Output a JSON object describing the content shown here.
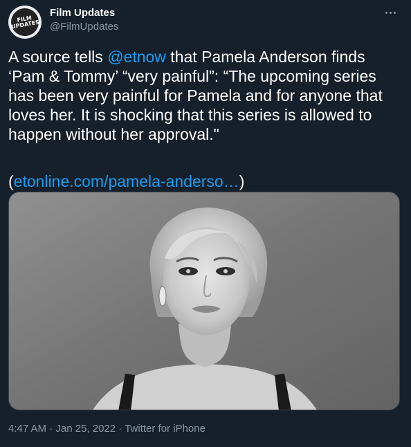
{
  "account": {
    "display_name": "Film Updates",
    "handle": "@FilmUpdates",
    "avatar_text_line1": "FILM",
    "avatar_text_line2": "UPDATES"
  },
  "tweet": {
    "text_part1": "A source tells ",
    "mention": "@etnow",
    "text_part2": " that Pamela Anderson finds ‘Pam & Tommy’ “very painful”: “The upcoming series has been very painful for Pamela and for anyone that loves her. It is shocking that this series is allowed to happen without her approval.\"",
    "link_open": "(",
    "link_text": "etonline.com/pamela-anderso…",
    "link_close": ")",
    "time": "4:47 AM",
    "date": "Jan 25, 2022",
    "source": "Twitter for iPhone",
    "separator": " · "
  },
  "icons": {
    "more": "more-icon",
    "avatar": "film-updates-logo"
  },
  "colors": {
    "background": "#15202b",
    "text": "#ffffff",
    "secondary": "#8b98a5",
    "link": "#1d9bf0"
  }
}
